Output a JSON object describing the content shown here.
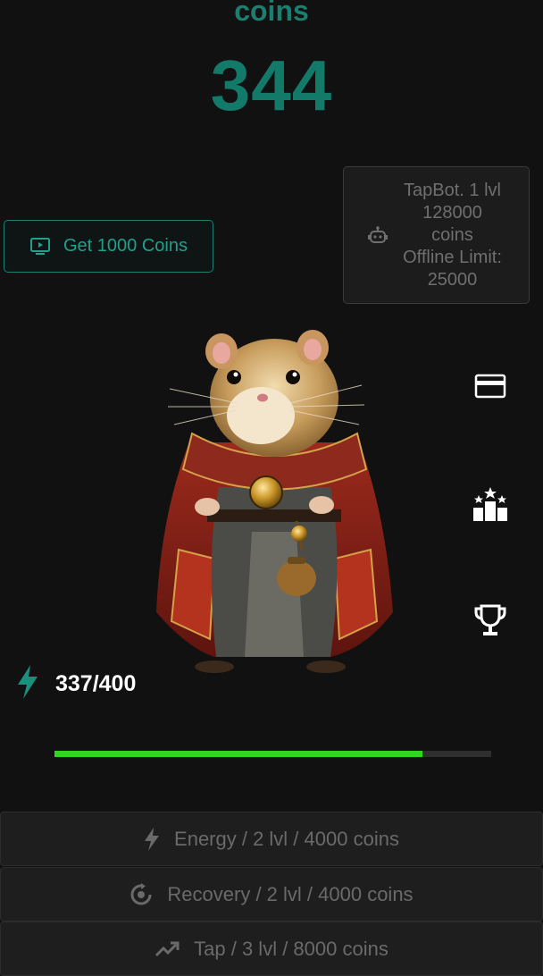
{
  "header": {
    "coins_label": "coins",
    "coins_value": "344"
  },
  "promo": {
    "get_coins_label": "Get 1000 Coins",
    "icon": "tv-play-icon"
  },
  "tapbot": {
    "icon": "robot-icon",
    "line1": "TapBot. 1 lvl",
    "line2": "128000",
    "line3": "coins",
    "line4": "Offline Limit:",
    "line5": "25000"
  },
  "side_menu": [
    {
      "icon": "card-icon"
    },
    {
      "icon": "leaderboard-icon"
    },
    {
      "icon": "trophy-icon"
    }
  ],
  "energy": {
    "icon": "lightning-icon",
    "text": "337/400",
    "current": 337,
    "max": 400
  },
  "colors": {
    "accent": "#137a6a",
    "progress": "#2ed81c",
    "background": "#111111"
  },
  "upgrades": [
    {
      "icon": "lightning-icon",
      "label": "Energy / 2 lvl / 4000 coins"
    },
    {
      "icon": "recovery-icon",
      "label": "Recovery / 2 lvl / 4000 coins"
    },
    {
      "icon": "trending-up-icon",
      "label": "Tap / 3 lvl / 8000 coins"
    }
  ]
}
